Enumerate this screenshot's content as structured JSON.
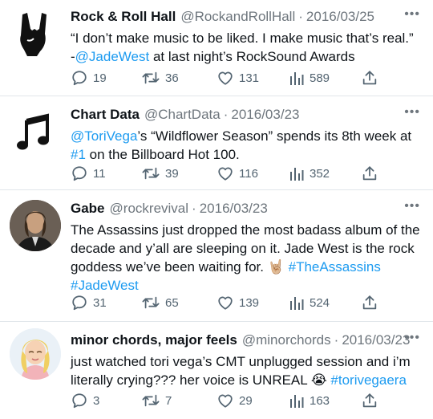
{
  "tweets": [
    {
      "name": "Rock & Roll Hall",
      "handle": "@RockandRollHall",
      "date": "2016/03/25",
      "avatar": "rock-hand-icon",
      "text_parts": [
        {
          "t": "“I don’t make music to be liked. I make music that’s real.” -",
          "link": false
        },
        {
          "t": "@JadeWest",
          "link": true
        },
        {
          "t": " at last night’s RockSound Awards",
          "link": false
        }
      ],
      "replies": "19",
      "retweets": "36",
      "likes": "131",
      "views": "589"
    },
    {
      "name": "Chart Data",
      "handle": "@ChartData",
      "date": "2016/03/23",
      "avatar": "music-note-icon",
      "text_parts": [
        {
          "t": "@ToriVega",
          "link": true
        },
        {
          "t": "’s “Wildflower Season” spends its 8th week at ",
          "link": false
        },
        {
          "t": "#1",
          "link": true
        },
        {
          "t": " on the Billboard Hot 100.",
          "link": false
        }
      ],
      "replies": "11",
      "retweets": "39",
      "likes": "116",
      "views": "352"
    },
    {
      "name": "Gabe",
      "handle": "@rockrevival",
      "date": "2016/03/23",
      "avatar": "profile-photo",
      "text_parts": [
        {
          "t": "The Assassins just dropped the most badass album of the decade and y’all are sleeping on it. Jade West is the rock goddess we’ve been waiting for. 🤘🏼 ",
          "link": false
        },
        {
          "t": "#TheAssassins",
          "link": true
        },
        {
          "t": " ",
          "link": false
        },
        {
          "t": "#JadeWest",
          "link": true
        }
      ],
      "replies": "31",
      "retweets": "65",
      "likes": "139",
      "views": "524"
    },
    {
      "name": "minor chords, major feels",
      "handle": "@minorchords",
      "date": "2016/03/23",
      "avatar": "cartoon-avatar",
      "text_parts": [
        {
          "t": "just watched tori vega’s CMT unplugged session and i’m literally crying??? her voice is UNREAL 😭 ",
          "link": false
        },
        {
          "t": "#torivegaera",
          "link": true
        }
      ],
      "replies": "3",
      "retweets": "7",
      "likes": "29",
      "views": "163"
    }
  ],
  "colors": {
    "link": "#1d9bf0",
    "meta": "#6e767d",
    "icon": "#536471",
    "divider": "#e1e6ea"
  }
}
